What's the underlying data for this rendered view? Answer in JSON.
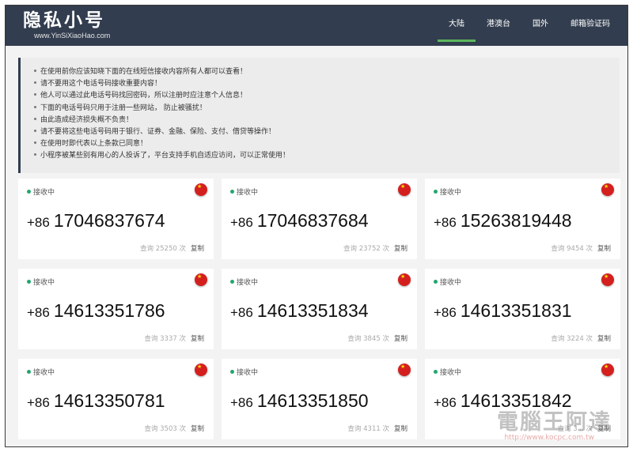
{
  "header": {
    "logo_main": "隐私小号",
    "logo_sub": "www.YinSiXiaoHao.com",
    "nav": [
      "大陆",
      "港澳台",
      "国外",
      "邮箱验证码"
    ]
  },
  "notice": [
    "在使用前你应该知晓下面的在线短信接收内容所有人都可以查看！",
    "请不要用这个电话号码接收重要内容！",
    "他人可以通过此电话号码找回密码，所以注册时应注意个人信息！",
    "下面的电话号码只用于注册一些网站， 防止被骚扰！",
    "由此造成经济损失概不负责！",
    "请不要将这些电话号码用于银行、证券、金融、保险、支付、借贷等操作！",
    "在使用时即代表以上条款已同意！",
    "小程序被某些别有用心的人投诉了，平台支持手机自适应访问，可以正常使用！"
  ],
  "cards": [
    {
      "status": "接收中",
      "cc": "+86",
      "number": "17046837674",
      "views": "查询 25250 次",
      "copy": "复制"
    },
    {
      "status": "接收中",
      "cc": "+86",
      "number": "17046837684",
      "views": "查询 23752 次",
      "copy": "复制"
    },
    {
      "status": "接收中",
      "cc": "+86",
      "number": "15263819448",
      "views": "查询 9454 次",
      "copy": "复制"
    },
    {
      "status": "接收中",
      "cc": "+86",
      "number": "14613351786",
      "views": "查询 3337 次",
      "copy": "复制"
    },
    {
      "status": "接收中",
      "cc": "+86",
      "number": "14613351834",
      "views": "查询 3845 次",
      "copy": "复制"
    },
    {
      "status": "接收中",
      "cc": "+86",
      "number": "14613351831",
      "views": "查询 3224 次",
      "copy": "复制"
    },
    {
      "status": "接收中",
      "cc": "+86",
      "number": "14613350781",
      "views": "查询 3503 次",
      "copy": "复制"
    },
    {
      "status": "接收中",
      "cc": "+86",
      "number": "14613351850",
      "views": "查询 4311 次",
      "copy": "复制"
    },
    {
      "status": "接收中",
      "cc": "+86",
      "number": "14613351842",
      "views": "查询 3... 次",
      "copy": "复制"
    }
  ],
  "watermark": {
    "text": "電腦王阿達",
    "url": "http://www.kocpc.com.tw"
  },
  "colors": {
    "navbar": "#323d4f",
    "active_underline": "#5cb85c",
    "status_dot": "#23a66f",
    "flag": "#d41f1f"
  },
  "icons": {
    "flag": "china-flag-icon",
    "status": "green-dot-icon"
  }
}
